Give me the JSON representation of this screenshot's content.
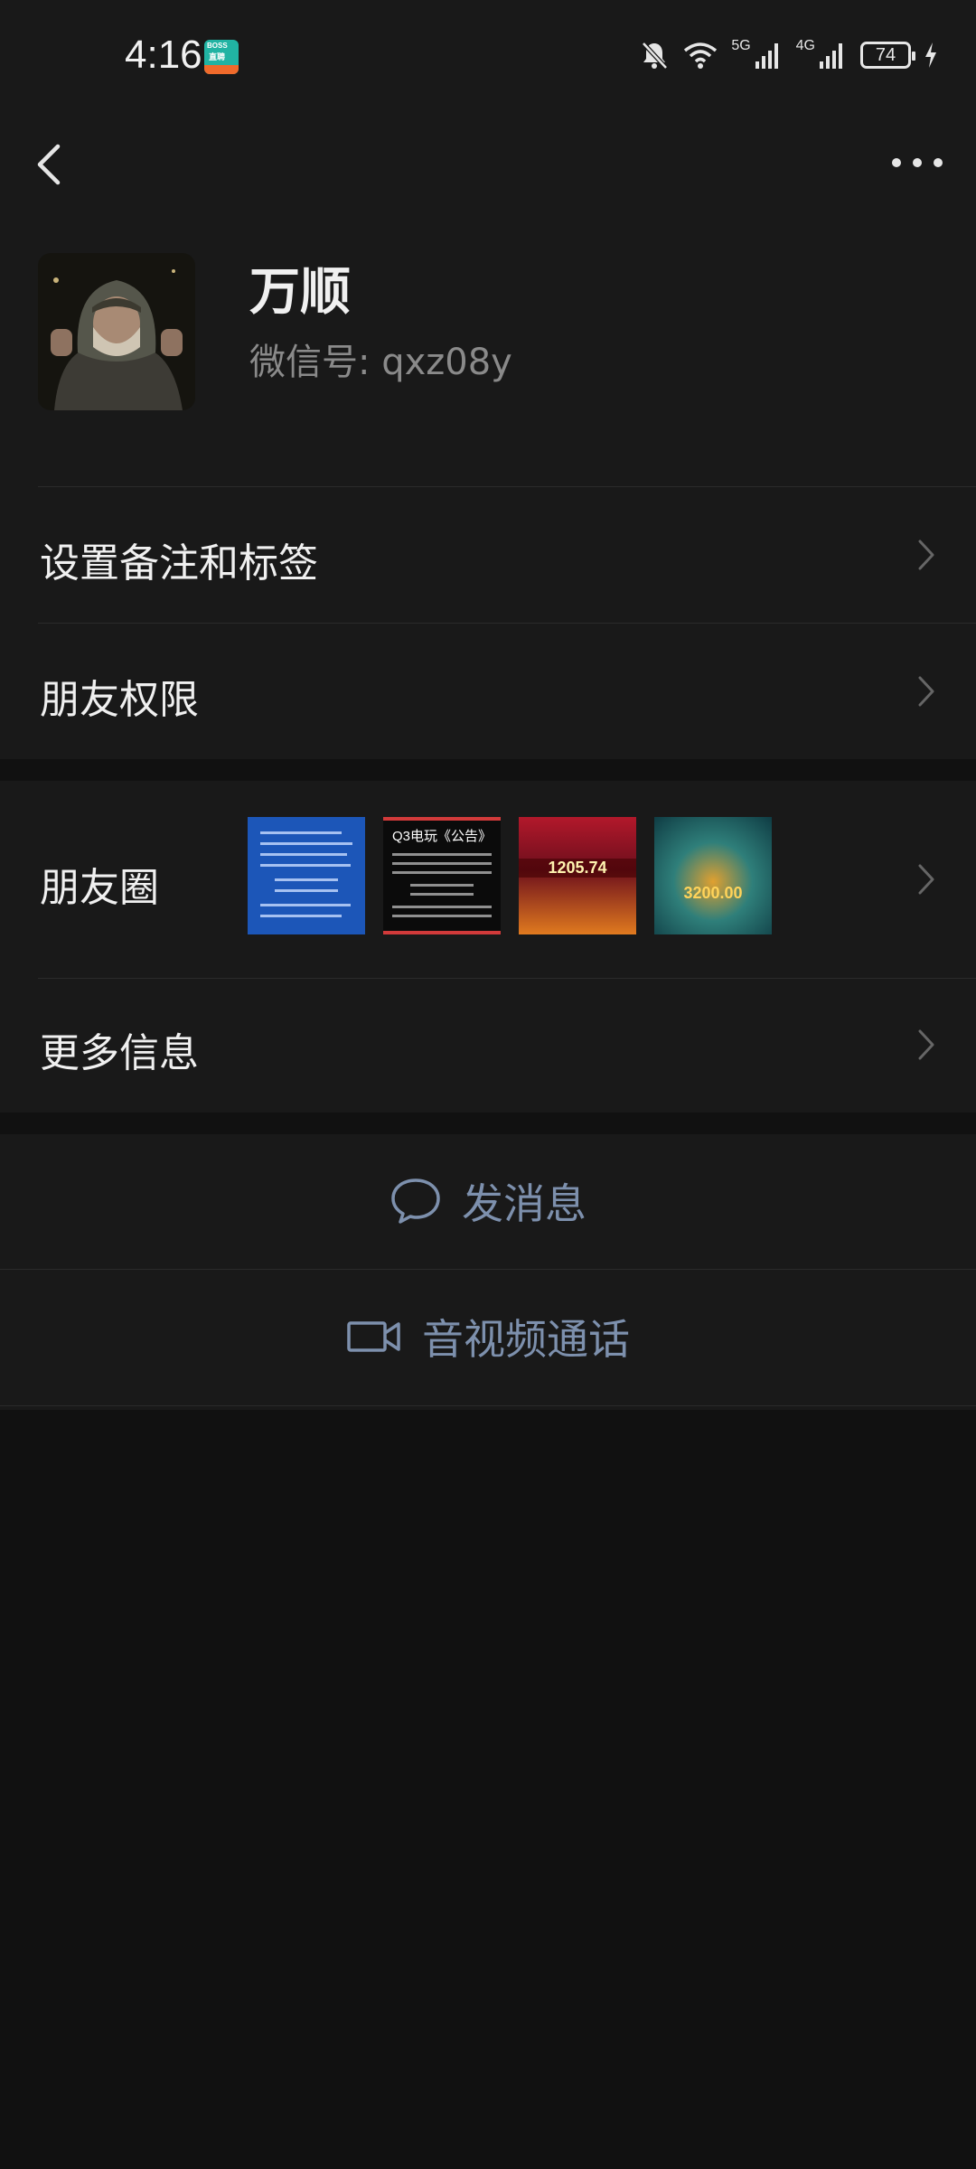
{
  "status_bar": {
    "time": "4:16",
    "app_badge": {
      "line1": "BOSS",
      "line2": "直聘"
    },
    "network_1": "5G",
    "network_2": "4G",
    "battery": "74"
  },
  "nav": {
    "back_icon": "chevron-left-icon",
    "more_icon": "more-dots-icon"
  },
  "profile": {
    "name": "万顺",
    "wechat_id": "微信号: qxz08y"
  },
  "menu": {
    "remark_tags": "设置备注和标签",
    "permissions": "朋友权限",
    "moments": "朋友圈",
    "more_info": "更多信息"
  },
  "moments_thumbs": {
    "thumb2_caption": "Q3电玩《公告》",
    "thumb3_amount": "1205.74",
    "thumb4_amount": "3200.00"
  },
  "actions": {
    "send_message": "发消息",
    "video_call": "音视频通话"
  },
  "colors": {
    "background": "#111111",
    "panel": "#191919",
    "action_text": "#7d90ad"
  }
}
